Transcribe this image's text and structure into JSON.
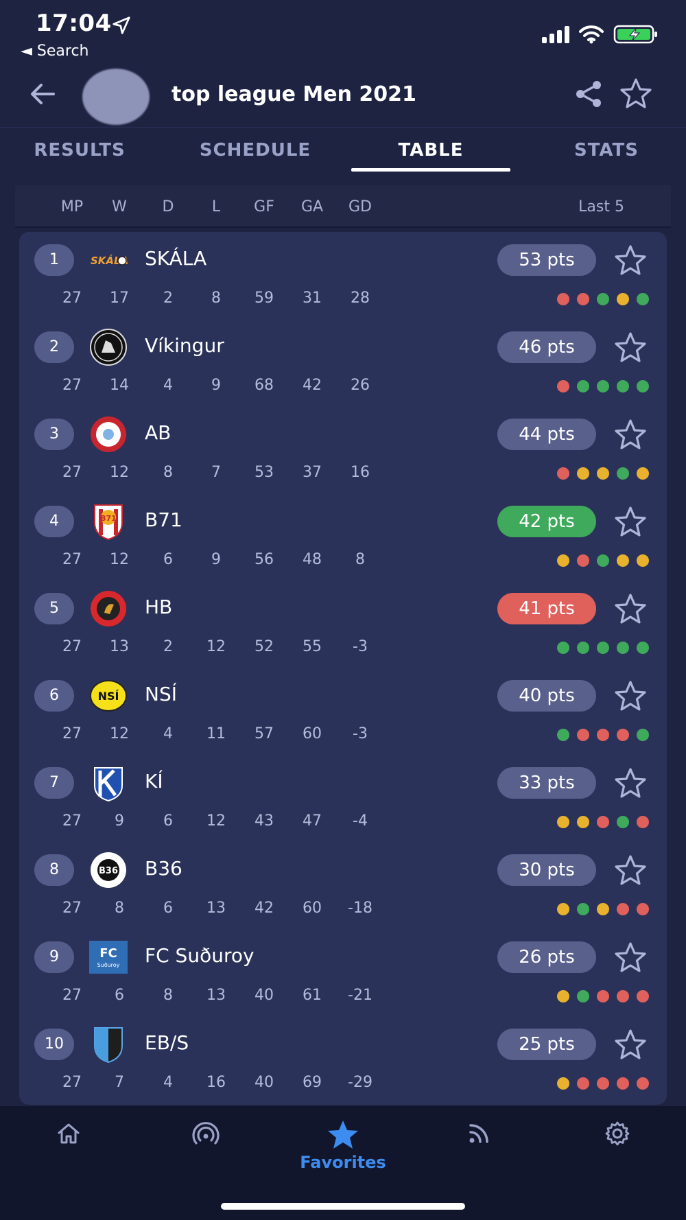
{
  "status_bar": {
    "time": "17:04",
    "back_app": "◄ Search"
  },
  "header": {
    "title": "top league Men 2021"
  },
  "tabs": [
    "RESULTS",
    "SCHEDULE",
    "TABLE",
    "STATS"
  ],
  "columns": [
    "MP",
    "W",
    "D",
    "L",
    "GF",
    "GA",
    "GD"
  ],
  "last5_label": "Last 5",
  "colors": {
    "win": "#3fa95c",
    "draw": "#e8b22f",
    "loss": "#e0605c",
    "accent": "#3d8df0"
  },
  "teams": [
    {
      "rank": "1",
      "name": "SKÁLA",
      "pts": "53 pts",
      "mp": "27",
      "w": "17",
      "d": "2",
      "l": "8",
      "gf": "59",
      "ga": "31",
      "gd": "28",
      "form": [
        "L",
        "L",
        "W",
        "D",
        "W"
      ],
      "logo": "skala-logo"
    },
    {
      "rank": "2",
      "name": "Víkingur",
      "pts": "46 pts",
      "mp": "27",
      "w": "14",
      "d": "4",
      "l": "9",
      "gf": "68",
      "ga": "42",
      "gd": "26",
      "form": [
        "L",
        "W",
        "W",
        "W",
        "W"
      ],
      "logo": "vikingur-logo"
    },
    {
      "rank": "3",
      "name": "AB",
      "pts": "44 pts",
      "mp": "27",
      "w": "12",
      "d": "8",
      "l": "7",
      "gf": "53",
      "ga": "37",
      "gd": "16",
      "form": [
        "L",
        "D",
        "D",
        "W",
        "D"
      ],
      "logo": "ab-logo"
    },
    {
      "rank": "4",
      "name": "B71",
      "pts": "42 pts",
      "mp": "27",
      "w": "12",
      "d": "6",
      "l": "9",
      "gf": "56",
      "ga": "48",
      "gd": "8",
      "form": [
        "D",
        "L",
        "W",
        "D",
        "D"
      ],
      "logo": "b71-logo"
    },
    {
      "rank": "5",
      "name": "HB",
      "pts": "41 pts",
      "mp": "27",
      "w": "13",
      "d": "2",
      "l": "12",
      "gf": "52",
      "ga": "55",
      "gd": "-3",
      "form": [
        "W",
        "W",
        "W",
        "W",
        "W"
      ],
      "logo": "hb-logo"
    },
    {
      "rank": "6",
      "name": "NSÍ",
      "pts": "40 pts",
      "mp": "27",
      "w": "12",
      "d": "4",
      "l": "11",
      "gf": "57",
      "ga": "60",
      "gd": "-3",
      "form": [
        "W",
        "L",
        "L",
        "L",
        "W"
      ],
      "logo": "nsi-logo"
    },
    {
      "rank": "7",
      "name": "KÍ",
      "pts": "33 pts",
      "mp": "27",
      "w": "9",
      "d": "6",
      "l": "12",
      "gf": "43",
      "ga": "47",
      "gd": "-4",
      "form": [
        "D",
        "D",
        "L",
        "W",
        "L"
      ],
      "logo": "ki-logo"
    },
    {
      "rank": "8",
      "name": "B36",
      "pts": "30 pts",
      "mp": "27",
      "w": "8",
      "d": "6",
      "l": "13",
      "gf": "42",
      "ga": "60",
      "gd": "-18",
      "form": [
        "D",
        "W",
        "D",
        "L",
        "L"
      ],
      "logo": "b36-logo"
    },
    {
      "rank": "9",
      "name": "FC Suðuroy",
      "pts": "26 pts",
      "mp": "27",
      "w": "6",
      "d": "8",
      "l": "13",
      "gf": "40",
      "ga": "61",
      "gd": "-21",
      "form": [
        "D",
        "W",
        "L",
        "L",
        "L"
      ],
      "logo": "fc-suduroy-logo"
    },
    {
      "rank": "10",
      "name": "EB/S",
      "pts": "25 pts",
      "mp": "27",
      "w": "7",
      "d": "4",
      "l": "16",
      "gf": "40",
      "ga": "69",
      "gd": "-29",
      "form": [
        "D",
        "L",
        "L",
        "L",
        "L"
      ],
      "logo": "ebs-logo"
    }
  ],
  "bottom_nav": {
    "items": [
      "home-icon",
      "live-icon",
      "favorites-star-icon",
      "feed-icon",
      "settings-icon"
    ],
    "favorites_label": "Favorites",
    "active": "Favorites"
  }
}
